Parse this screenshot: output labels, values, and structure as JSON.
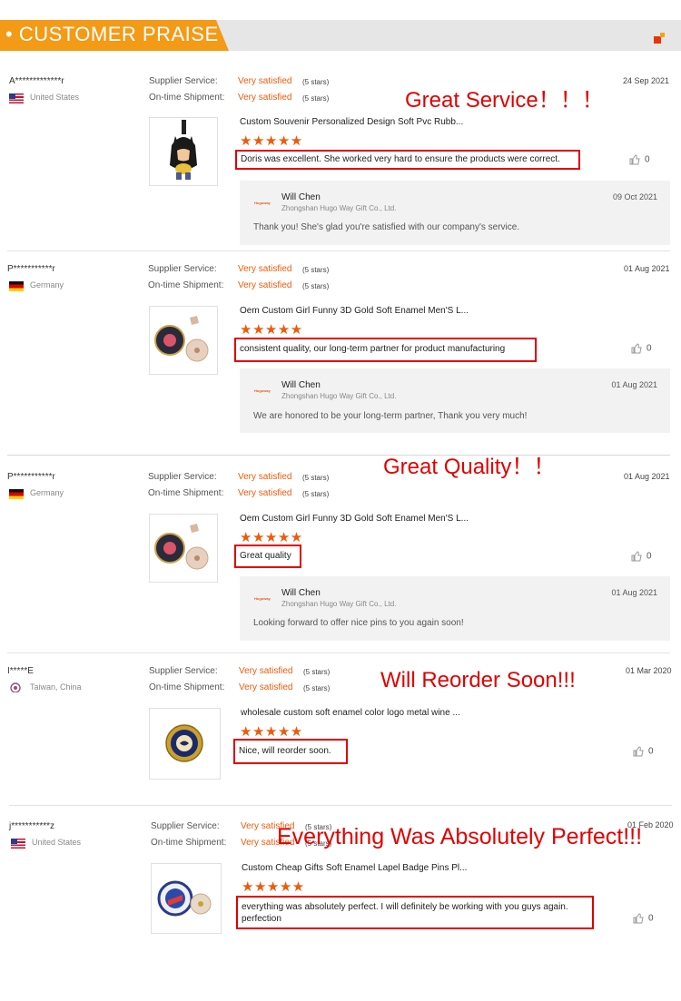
{
  "header": {
    "title": "• CUSTOMER PRAISE"
  },
  "labels": {
    "supplier_service": "Supplier Service:",
    "ontime_shipment": "On-time Shipment:"
  },
  "reviews": [
    {
      "reviewer": "A*************r",
      "country": "United States",
      "date": "24 Sep 2021",
      "supplier_service": "Very satisfied",
      "supplier_stars": "(5 stars)",
      "ontime_shipment": "Very satisfied",
      "ontime_stars": "(5 stars)",
      "product_title": "Custom Souvenir Personalized Design Soft Pvc Rubb...",
      "rating": "★★★★★",
      "comment": "Doris was excellent. She worked very hard to ensure the products were correct.",
      "likes": "0",
      "reply": {
        "logo": "Hugoway",
        "name": "Will Chen",
        "company": "Zhongshan Hugo Way Gift Co., Ltd.",
        "date": "09 Oct 2021",
        "text": "Thank you! She's glad you're satisfied with our company's service."
      }
    },
    {
      "reviewer": "P***********r",
      "country": "Germany",
      "date": "01 Aug 2021",
      "supplier_service": "Very satisfied",
      "supplier_stars": "(5 stars)",
      "ontime_shipment": "Very satisfied",
      "ontime_stars": "(5 stars)",
      "product_title": "Oem Custom Girl Funny 3D Gold Soft Enamel Men'S L...",
      "rating": "★★★★★",
      "comment": "consistent quality, our long-term partner for product manufacturing",
      "likes": "0",
      "reply": {
        "logo": "Hugoway",
        "name": "Will Chen",
        "company": "Zhongshan Hugo Way Gift Co., Ltd.",
        "date": "01 Aug 2021",
        "text": "We are honored to be your long-term partner, Thank you very much!"
      }
    },
    {
      "reviewer": "P***********r",
      "country": "Germany",
      "date": "01 Aug 2021",
      "supplier_service": "Very satisfied",
      "supplier_stars": "(5 stars)",
      "ontime_shipment": "Very satisfied",
      "ontime_stars": "(5 stars)",
      "product_title": "Oem Custom Girl Funny 3D Gold Soft Enamel Men'S L...",
      "rating": "★★★★★",
      "comment": "Great quality",
      "likes": "0",
      "reply": {
        "logo": "Hugoway",
        "name": "Will Chen",
        "company": "Zhongshan Hugo Way Gift Co., Ltd.",
        "date": "01 Aug 2021",
        "text": "Looking forward to offer nice pins to you again soon!"
      }
    },
    {
      "reviewer": "I*****E",
      "country": "Taiwan, China",
      "date": "01 Mar 2020",
      "supplier_service": "Very satisfied",
      "supplier_stars": "(5 stars)",
      "ontime_shipment": "Very satisfied",
      "ontime_stars": "(5 stars)",
      "product_title": "wholesale custom soft enamel color logo metal wine ...",
      "rating": "★★★★★",
      "comment": "Nice, will reorder soon.",
      "likes": "0"
    },
    {
      "reviewer": "j***********z",
      "country": "United States",
      "date": "01 Feb 2020",
      "supplier_service": "Very satisfied",
      "supplier_stars": "(5 stars)",
      "ontime_shipment": "Very satisfied",
      "ontime_stars": "(5 stars)",
      "product_title": "Custom Cheap Gifts Soft Enamel Lapel Badge Pins Pl...",
      "rating": "★★★★★",
      "comment": "everything was absolutely perfect. I will definitely be working with you guys again. perfection",
      "likes": "0"
    }
  ],
  "annotations": {
    "service": "Great Service！！！",
    "quality": "Great Quality！！",
    "reorder": "Will Reorder Soon!!!",
    "perfect": "Everything Was Absolutely Perfect!!!"
  },
  "colors": {
    "accent": "#ee5a0a",
    "banner": "#f39a16",
    "highlight": "#e10000"
  }
}
